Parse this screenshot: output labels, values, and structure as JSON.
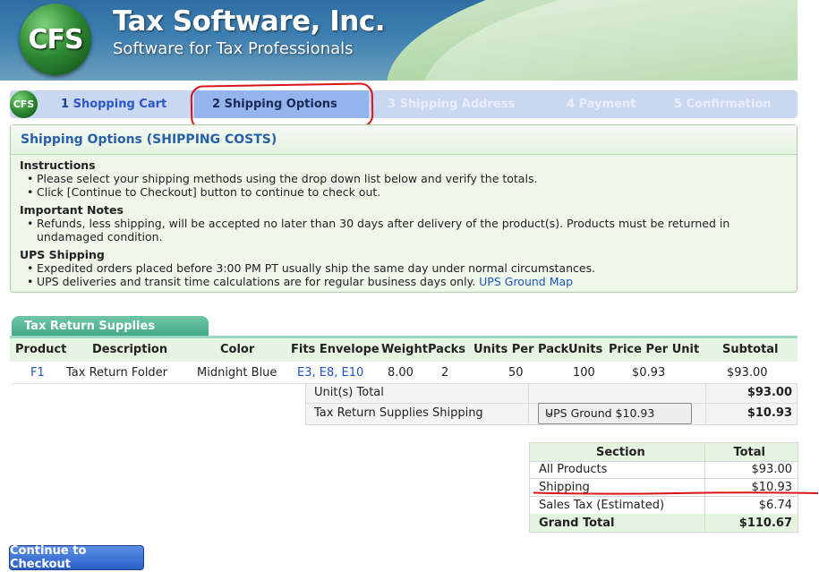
{
  "brand": {
    "logo_text": "CFS",
    "title": "Tax Software, Inc.",
    "subtitle": "Software for Tax Professionals"
  },
  "steps": {
    "mini_logo": "CFS",
    "items": [
      {
        "num": "1",
        "label": "Shopping Cart"
      },
      {
        "num": "2",
        "label": "Shipping Options"
      },
      {
        "num": "3",
        "label": "Shipping Address"
      },
      {
        "num": "4",
        "label": "Payment"
      },
      {
        "num": "5",
        "label": "Confirmation"
      }
    ]
  },
  "shipping": {
    "title": "Shipping Options (SHIPPING COSTS)",
    "instructions_title": "Instructions",
    "instructions": [
      "Please select your shipping methods using the drop down list below and verify the totals.",
      "Click [Continue to Checkout] button to continue to check out."
    ],
    "notes_title": "Important Notes",
    "notes": [
      "Refunds, less shipping, will be accepted no later than 30 days after delivery of the product(s). Products must be returned in undamaged condition."
    ],
    "ups_title": "UPS Shipping",
    "ups": [
      "Expedited orders placed before 3:00 PM PT usually ship the same day under normal circumstances.",
      "UPS deliveries and transit time calculations are for regular business days only."
    ],
    "ups_link": "UPS Ground Map"
  },
  "supplies": {
    "tab": "Tax Return Supplies",
    "columns": [
      "Product",
      "Description",
      "Color",
      "Fits Envelope",
      "Weight",
      "Packs",
      "Units Per Pack",
      "Units",
      "Price Per Unit",
      "Subtotal"
    ],
    "rows": [
      {
        "product": "F1",
        "description": "Tax Return Folder",
        "color": "Midnight Blue",
        "fits": "E3, E8, E10",
        "weight": "8.00",
        "packs": "2",
        "units_per_pack": "50",
        "units": "100",
        "price": "$0.93",
        "subtotal": "$93.00"
      }
    ],
    "units_total_label": "Unit(s) Total",
    "units_total": "$93.00",
    "shipping_label": "Tax Return Supplies Shipping",
    "shipping_select": "UPS Ground $10.93",
    "shipping_total": "$10.93"
  },
  "totals": {
    "header_section": "Section",
    "header_total": "Total",
    "rows": [
      {
        "label": "All Products",
        "value": "$93.00"
      },
      {
        "label": "Shipping",
        "value": "$10.93"
      },
      {
        "label": "Sales Tax (Estimated)",
        "value": "$6.74"
      }
    ],
    "grand_label": "Grand Total",
    "grand_value": "$110.67"
  },
  "checkout_button": "Continue to Checkout",
  "colors": {
    "accent": "#2860a8",
    "annotation": "#d8141b",
    "panel_bg": "#edf7ea"
  }
}
